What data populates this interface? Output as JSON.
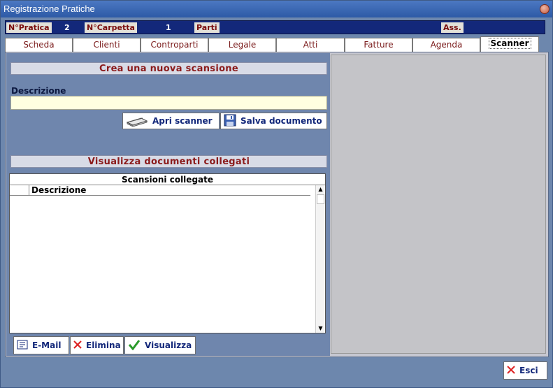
{
  "window": {
    "title": "Registrazione Pratiche"
  },
  "infobar": {
    "pratica_label": "N°Pratica",
    "pratica_value": "2",
    "carpetta_label": "N°Carpetta",
    "carpetta_value": "1",
    "parti_label": "Parti",
    "ass_label": "Ass."
  },
  "tabs": [
    {
      "label": "Scheda"
    },
    {
      "label": "Clienti"
    },
    {
      "label": "Controparti"
    },
    {
      "label": "Legale"
    },
    {
      "label": "Atti"
    },
    {
      "label": "Fatture"
    },
    {
      "label": "Agenda"
    },
    {
      "label": "Scanner"
    }
  ],
  "active_tab": "Scanner",
  "scanner": {
    "new_scan_header": "Crea una nuova scansione",
    "description_label": "Descrizione",
    "description_value": "",
    "open_scanner_label": "Apri scanner",
    "save_document_label": "Salva documento",
    "linked_header": "Visualizza documenti collegati",
    "list_title": "Scansioni collegate",
    "list_column": "Descrizione",
    "email_label": "E-Mail",
    "delete_label": "Elimina",
    "view_label": "Visualizza"
  },
  "footer": {
    "exit_label": "Esci"
  },
  "colors": {
    "accent_dark_blue": "#13287a",
    "label_red": "#8b1a1a",
    "input_yellow": "#ffffe0"
  },
  "icons": [
    "close-icon",
    "scanner-icon",
    "floppy-disk-icon",
    "email-icon",
    "delete-x-icon",
    "check-icon",
    "exit-x-icon"
  ]
}
